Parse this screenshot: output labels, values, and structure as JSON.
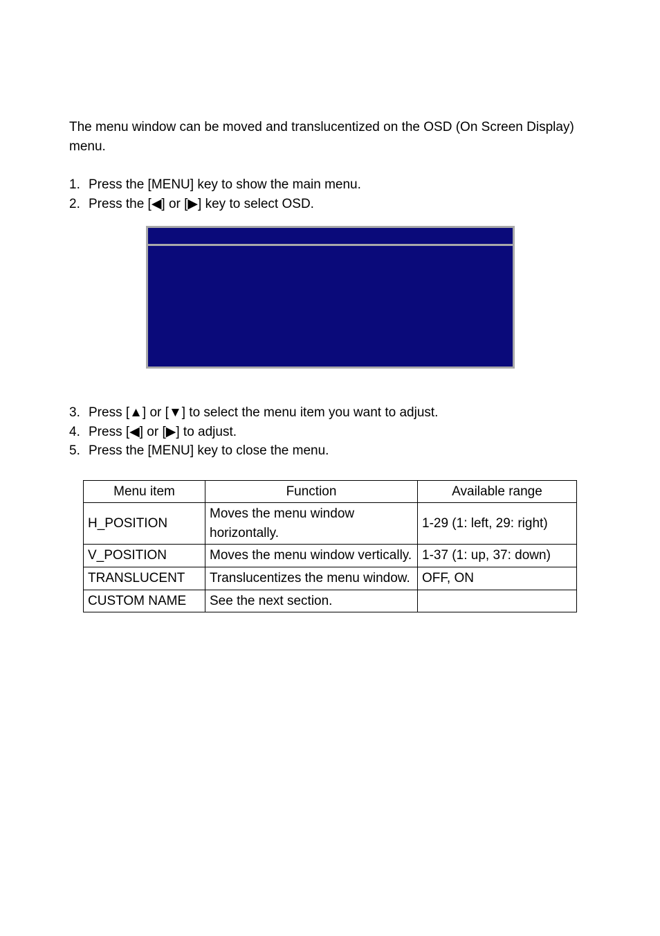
{
  "intro": "The menu window can be moved and translucentized on the OSD (On Screen Display) menu.",
  "stepsA": [
    {
      "num": "1.",
      "text": "Press the [MENU] key to show the main menu."
    },
    {
      "num": "2.",
      "text": "Press the [◀] or [▶] key to select OSD."
    }
  ],
  "stepsB": [
    {
      "num": "3.",
      "text": "Press [▲] or [▼] to select the menu item you want to adjust."
    },
    {
      "num": "4.",
      "text": "Press [◀] or [▶] to adjust."
    },
    {
      "num": "5.",
      "text": "Press the [MENU] key to close the menu."
    }
  ],
  "table": {
    "headers": {
      "menu": "Menu item",
      "func": "Function",
      "range": "Available range"
    },
    "rows": [
      {
        "menu": "H_POSITION",
        "func": "Moves the menu window horizontally.",
        "range": "1-29 (1: left, 29: right)"
      },
      {
        "menu": "V_POSITION",
        "func": "Moves the menu window vertically.",
        "range": "1-37 (1: up, 37: down)"
      },
      {
        "menu": "TRANSLUCENT",
        "func": "Translucentizes the menu window.",
        "range": "OFF, ON"
      },
      {
        "menu": "CUSTOM NAME",
        "func": "See the next section.",
        "range": ""
      }
    ]
  }
}
